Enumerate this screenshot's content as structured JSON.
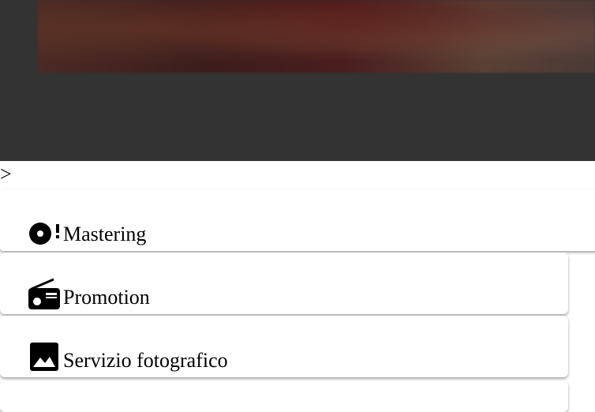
{
  "stray_text": ">",
  "services": [
    {
      "label": "Mastering",
      "icon": "disc-alert-icon"
    },
    {
      "label": "Promotion",
      "icon": "radio-icon"
    },
    {
      "label": "Servizio fotografico",
      "icon": "image-icon"
    }
  ],
  "colors": {
    "hero_background": "#333333",
    "card_background": "#ffffff",
    "text": "#000000"
  }
}
